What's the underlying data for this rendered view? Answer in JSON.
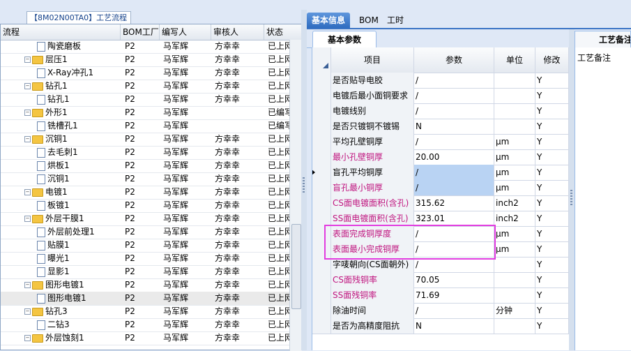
{
  "left_panel": {
    "tab_title": "【8M02N00TA0】工艺流程",
    "columns": [
      "流程",
      "BOM工厂",
      "编写人",
      "审核人",
      "状态"
    ],
    "rows": [
      {
        "level": 2,
        "type": "doc",
        "name": "陶瓷磨板",
        "bom": "P2",
        "writer": "马军辉",
        "reviewer": "方幸幸",
        "status": "已上网"
      },
      {
        "level": 1,
        "type": "folder",
        "name": "层压1",
        "bom": "P2",
        "writer": "马军辉",
        "reviewer": "方幸幸",
        "status": "已上网"
      },
      {
        "level": 2,
        "type": "doc",
        "name": "X-Ray冲孔1",
        "bom": "P2",
        "writer": "马军辉",
        "reviewer": "方幸幸",
        "status": "已上网"
      },
      {
        "level": 1,
        "type": "folder",
        "name": "钻孔1",
        "bom": "P2",
        "writer": "马军辉",
        "reviewer": "方幸幸",
        "status": "已上网"
      },
      {
        "level": 2,
        "type": "doc",
        "name": "钻孔1",
        "bom": "P2",
        "writer": "马军辉",
        "reviewer": "方幸幸",
        "status": "已上网"
      },
      {
        "level": 1,
        "type": "folder",
        "name": "外形1",
        "bom": "P2",
        "writer": "马军辉",
        "reviewer": "",
        "status": "已编写"
      },
      {
        "level": 2,
        "type": "doc",
        "name": "铣槽孔1",
        "bom": "P2",
        "writer": "马军辉",
        "reviewer": "",
        "status": "已编写"
      },
      {
        "level": 1,
        "type": "folder",
        "name": "沉铜1",
        "bom": "P2",
        "writer": "马军辉",
        "reviewer": "方幸幸",
        "status": "已上网"
      },
      {
        "level": 2,
        "type": "doc",
        "name": "去毛刺1",
        "bom": "P2",
        "writer": "马军辉",
        "reviewer": "方幸幸",
        "status": "已上网"
      },
      {
        "level": 2,
        "type": "doc",
        "name": "烘板1",
        "bom": "P2",
        "writer": "马军辉",
        "reviewer": "方幸幸",
        "status": "已上网"
      },
      {
        "level": 2,
        "type": "doc",
        "name": "沉铜1",
        "bom": "P2",
        "writer": "马军辉",
        "reviewer": "方幸幸",
        "status": "已上网"
      },
      {
        "level": 1,
        "type": "folder",
        "name": "电镀1",
        "bom": "P2",
        "writer": "马军辉",
        "reviewer": "方幸幸",
        "status": "已上网"
      },
      {
        "level": 2,
        "type": "doc",
        "name": "板镀1",
        "bom": "P2",
        "writer": "马军辉",
        "reviewer": "方幸幸",
        "status": "已上网"
      },
      {
        "level": 1,
        "type": "folder",
        "name": "外层干膜1",
        "bom": "P2",
        "writer": "马军辉",
        "reviewer": "方幸幸",
        "status": "已上网"
      },
      {
        "level": 2,
        "type": "doc",
        "name": "外层前处理1",
        "bom": "P2",
        "writer": "马军辉",
        "reviewer": "方幸幸",
        "status": "已上网"
      },
      {
        "level": 2,
        "type": "doc",
        "name": "贴膜1",
        "bom": "P2",
        "writer": "马军辉",
        "reviewer": "方幸幸",
        "status": "已上网"
      },
      {
        "level": 2,
        "type": "doc",
        "name": "曝光1",
        "bom": "P2",
        "writer": "马军辉",
        "reviewer": "方幸幸",
        "status": "已上网"
      },
      {
        "level": 2,
        "type": "doc",
        "name": "显影1",
        "bom": "P2",
        "writer": "马军辉",
        "reviewer": "方幸幸",
        "status": "已上网"
      },
      {
        "level": 1,
        "type": "folder",
        "name": "图形电镀1",
        "bom": "P2",
        "writer": "马军辉",
        "reviewer": "方幸幸",
        "status": "已上网"
      },
      {
        "level": 2,
        "type": "doc",
        "name": "图形电镀1",
        "bom": "P2",
        "writer": "马军辉",
        "reviewer": "方幸幸",
        "status": "已上网",
        "selected": true
      },
      {
        "level": 1,
        "type": "folder",
        "name": "钻孔3",
        "bom": "P2",
        "writer": "马军辉",
        "reviewer": "方幸幸",
        "status": "已上网"
      },
      {
        "level": 2,
        "type": "doc",
        "name": "二钻3",
        "bom": "P2",
        "writer": "马军辉",
        "reviewer": "方幸幸",
        "status": "已上网"
      },
      {
        "level": 1,
        "type": "folder",
        "name": "外层蚀刻1",
        "bom": "P2",
        "writer": "马军辉",
        "reviewer": "方幸幸",
        "status": "已上网"
      }
    ]
  },
  "main_tabs": [
    "基本信息",
    "BOM",
    "工时"
  ],
  "sub_tab": "基本参数",
  "grid": {
    "columns": [
      "项目",
      "参数",
      "单位",
      "修改"
    ],
    "rows": [
      {
        "name": "是否贴导电胶",
        "value": "/",
        "unit": "",
        "modify": "Y",
        "pink": false
      },
      {
        "name": "电镀后最小面铜要求",
        "value": "/",
        "unit": "",
        "modify": "Y",
        "pink": false
      },
      {
        "name": "电镀线别",
        "value": "/",
        "unit": "",
        "modify": "Y",
        "pink": false
      },
      {
        "name": "是否只镀铜不镀锡",
        "value": "N",
        "unit": "",
        "modify": "Y",
        "pink": false
      },
      {
        "name": "平均孔壁铜厚",
        "value": "/",
        "unit": "μm",
        "modify": "Y",
        "pink": false
      },
      {
        "name": "最小孔壁铜厚",
        "value": "20.00",
        "unit": "μm",
        "modify": "Y",
        "pink": true
      },
      {
        "name": "盲孔平均铜厚",
        "value": "/",
        "unit": "μm",
        "modify": "Y",
        "pink": false,
        "current": true,
        "blue_value": true
      },
      {
        "name": "盲孔最小铜厚",
        "value": "/",
        "unit": "μm",
        "modify": "Y",
        "pink": true,
        "blue_value": true
      },
      {
        "name": "CS面电镀面积(含孔)",
        "value": "315.62",
        "unit": "inch2",
        "modify": "Y",
        "pink": true
      },
      {
        "name": "SS面电镀面积(含孔)",
        "value": "323.01",
        "unit": "inch2",
        "modify": "Y",
        "pink": true
      },
      {
        "name": "表面完成铜厚度",
        "value": "/",
        "unit": "μm",
        "modify": "Y",
        "pink": true
      },
      {
        "name": "表面最小完成铜厚",
        "value": "/",
        "unit": "μm",
        "modify": "Y",
        "pink": true
      },
      {
        "name": "字唛朝向(CS面朝外)",
        "value": "/",
        "unit": "",
        "modify": "Y",
        "pink": false
      },
      {
        "name": "CS面残铜率",
        "value": "70.05",
        "unit": "",
        "modify": "Y",
        "pink": true
      },
      {
        "name": "SS面残铜率",
        "value": "71.69",
        "unit": "",
        "modify": "Y",
        "pink": true
      },
      {
        "name": "除油时间",
        "value": "/",
        "unit": "分钟",
        "modify": "Y",
        "pink": false
      },
      {
        "name": "是否为高精度阻抗",
        "value": "N",
        "unit": "",
        "modify": "Y",
        "pink": false
      }
    ]
  },
  "side_panel": {
    "tab": "工艺备注",
    "label": "工艺备注"
  },
  "colors": {
    "pink_text": "#c0157f",
    "highlight_box": "#e23ce0",
    "active_tab": "#2f6cc0"
  }
}
